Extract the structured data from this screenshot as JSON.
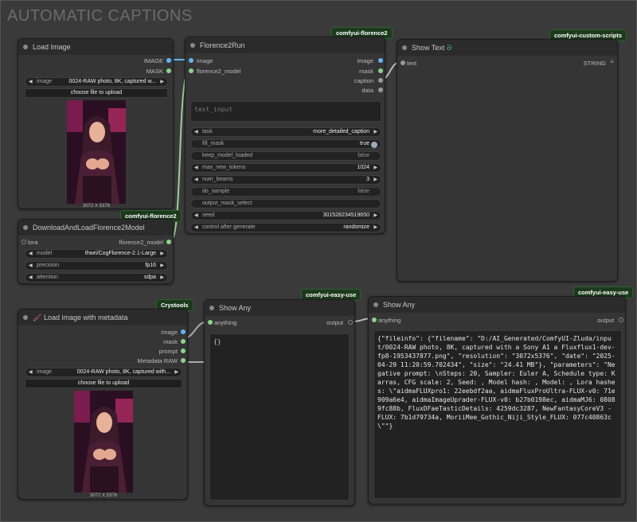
{
  "group": {
    "title": "AUTOMATIC CAPTIONS"
  },
  "badges": {
    "florence": "comfyui-florence2",
    "custom_scripts": "comfyui-custom-scripts",
    "easy_use_1": "comfyui-easy-use",
    "easy_use_2": "comfyui-easy-use",
    "crystools": "Crystools",
    "florence_lower": "comfyui-florence2"
  },
  "load_image": {
    "title": "Load Image",
    "outputs": [
      "IMAGE",
      "MASK"
    ],
    "image_label": "image",
    "image_value": "0024-RAW photo, 8K, captured w...",
    "upload_label": "choose file to upload",
    "size": "3072 X 5376"
  },
  "download_node": {
    "title": "DownloadAndLoadFlorence2Model",
    "input": "lora",
    "output": "florence2_model",
    "widgets": [
      {
        "label": "model",
        "value": "thwri/CogFlorence-2.1-Large"
      },
      {
        "label": "precision",
        "value": "fp16"
      },
      {
        "label": "attention",
        "value": "sdpa"
      }
    ]
  },
  "florence_run": {
    "title": "Florence2Run",
    "inputs": [
      "image",
      "florence2_model"
    ],
    "outputs": [
      "image",
      "mask",
      "caption",
      "data"
    ],
    "text_placeholder": "text_input",
    "widgets": [
      {
        "label": "task",
        "value": "more_detailed_caption"
      },
      {
        "label": "fill_mask",
        "value": "true"
      },
      {
        "label": "keep_model_loaded",
        "value": "false"
      },
      {
        "label": "max_new_tokens",
        "value": "1024"
      },
      {
        "label": "num_beams",
        "value": "3"
      },
      {
        "label": "do_sample",
        "value": "false"
      },
      {
        "label": "output_mask_select",
        "value": ""
      },
      {
        "label": "seed",
        "value": "301528234519650"
      },
      {
        "label": "control after generate",
        "value": "randomize"
      }
    ]
  },
  "show_text": {
    "title": "Show Text",
    "input": "text",
    "output": "STRING"
  },
  "load_meta": {
    "title": "Load image with metadata",
    "outputs": [
      "Image",
      "mask",
      "prompt",
      "Metadata RAW"
    ],
    "image_label": "image",
    "image_value": "0024-RAW photo, 8K, captured with...",
    "upload_label": "choose file to upload",
    "size": "3072 X 5376"
  },
  "show_any_1": {
    "title": "Show Any",
    "input": "anything",
    "output": "output",
    "text": "{}"
  },
  "show_any_2": {
    "title": "Show Any",
    "input": "anything",
    "output": "output",
    "text": "{\"fileinfo\": {\"filename\": \"D:/AI_Generated/ComfyUI-Zluda/input/0024-RAW photo, 8K, captured with a Sony A1 a Fluxflux1-dev-fp8-1953437877.png\", \"resolution\": \"3072x5376\", \"date\": \"2025-04-29 11:20:59.702434\", \"size\": \"24.41 MB\"}, \"parameters\": \"Negative prompt: \\nSteps: 20, Sampler: Euler A, Schedule type: Karras, CFG scale: 2, Seed: , Model hash: , Model: , Lora hashes: \\\"aidmaFLUXpro1: 22eebdf2aa, aidmaFluxProUltra-FLUX-v0: 71e909a6e4, aidmaImageUprader-FLUX-v0: b27b0198ec, aidmaMJ6: 08089fc88b, FluxDFaeTasticDetails: 4259dc3287, NewFantasyCoreV3 - FLUX: 7b1d79734a, MoriiMee_Gothic_Niji_Style_FLUX: 077c40863c\\\"\"}"
  },
  "colors": {
    "image_pin": "#64b5f6",
    "green_pin": "#8bd38b",
    "badge_bg": "#1d3a1d"
  }
}
